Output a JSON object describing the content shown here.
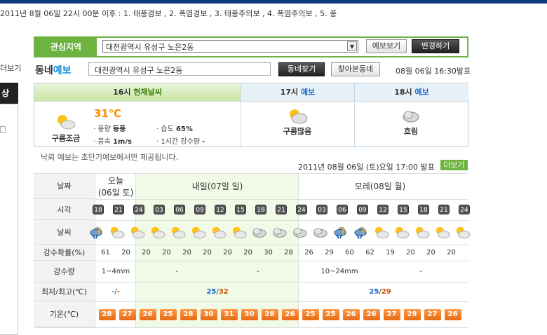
{
  "ticker": {
    "text": "2011년 8월 06일 22시 00분 이후 : 1. 태풍경보 , 2. 폭염경보 , 3. 태풍주의보 , 4. 폭염주의보 , 5. 풍"
  },
  "left_fragments": {
    "more": "더보기",
    "black": "상"
  },
  "region": {
    "label": "관심지역",
    "selected": "대전광역시 유성구 노은2동",
    "view_button": "예보보기",
    "change_button": "변경하기"
  },
  "dong": {
    "title_a": "동네",
    "title_b": "예보",
    "input_value": "대전광역시 유성구 노은2동",
    "find_button": "동네찾기",
    "history_button": "찾아본동네",
    "issued": "08월 06일 16:30발표"
  },
  "current": {
    "h16": {
      "time": "16시",
      "tag": "현재날씨"
    },
    "h17": {
      "time": "17시",
      "tag": "예보"
    },
    "h18": {
      "time": "18시",
      "tag": "예보"
    },
    "now_label": "구름조금",
    "temp": "31℃",
    "wind_dir_label": "풍향",
    "wind_dir": "동풍",
    "wind_speed_label": "풍속",
    "wind_speed": "1m/s",
    "humidity_label": "습도",
    "humidity": "65%",
    "rain_label": "1시간 강수량",
    "rain": "-",
    "h17_label": "구름많음",
    "h18_label": "흐림"
  },
  "note": "낙뢰 예보는 초단기예보에서만 제공됩니다.",
  "published": "2011년 08월 06일 (토)요일 17:00 발표",
  "more_button": "더보기",
  "table": {
    "headers": {
      "date": "날짜",
      "time": "시각",
      "weather": "날씨",
      "prob": "강수확률(%)",
      "amount": "강수량",
      "minmax": "최저/최고(℃)",
      "temp": "기온(℃)"
    },
    "days": {
      "today_a": "오늘",
      "today_b": "(06일 토)",
      "tomorrow": "내일(07일 일)",
      "after": "모레(08일 월)"
    },
    "hours": [
      "18",
      "21",
      "24",
      "03",
      "06",
      "09",
      "12",
      "15",
      "18",
      "21",
      "24",
      "03",
      "06",
      "09",
      "12",
      "15",
      "18",
      "21",
      "24"
    ],
    "weather": [
      "rain",
      "partly",
      "partly",
      "partly",
      "partly",
      "partly",
      "partly",
      "partly",
      "cloudy",
      "cloudy",
      "cloudy",
      "cloudy",
      "rain",
      "rain",
      "partly",
      "partly",
      "partly",
      "partly",
      "partly"
    ],
    "prob": [
      "61",
      "20",
      "20",
      "20",
      "20",
      "20",
      "20",
      "20",
      "30",
      "28",
      "26",
      "29",
      "60",
      "62",
      "19",
      "20",
      "20",
      "20"
    ],
    "amount": {
      "today": "1~4mm",
      "tomorrow_a": "-",
      "tomorrow_b": "-",
      "after_a": "10~24mm",
      "after_b": "-"
    },
    "minmax": {
      "today_min": "-",
      "today_sep": "/",
      "today_max": "-",
      "tomorrow_min": "25",
      "tomorrow_sep": "/",
      "tomorrow_max": "32",
      "after_min": "25",
      "after_sep": "/",
      "after_max": "29"
    },
    "temps": [
      "28",
      "27",
      "26",
      "25",
      "28",
      "30",
      "31",
      "30",
      "28",
      "26",
      "25",
      "25",
      "26",
      "26",
      "27",
      "29",
      "27",
      "26"
    ]
  }
}
